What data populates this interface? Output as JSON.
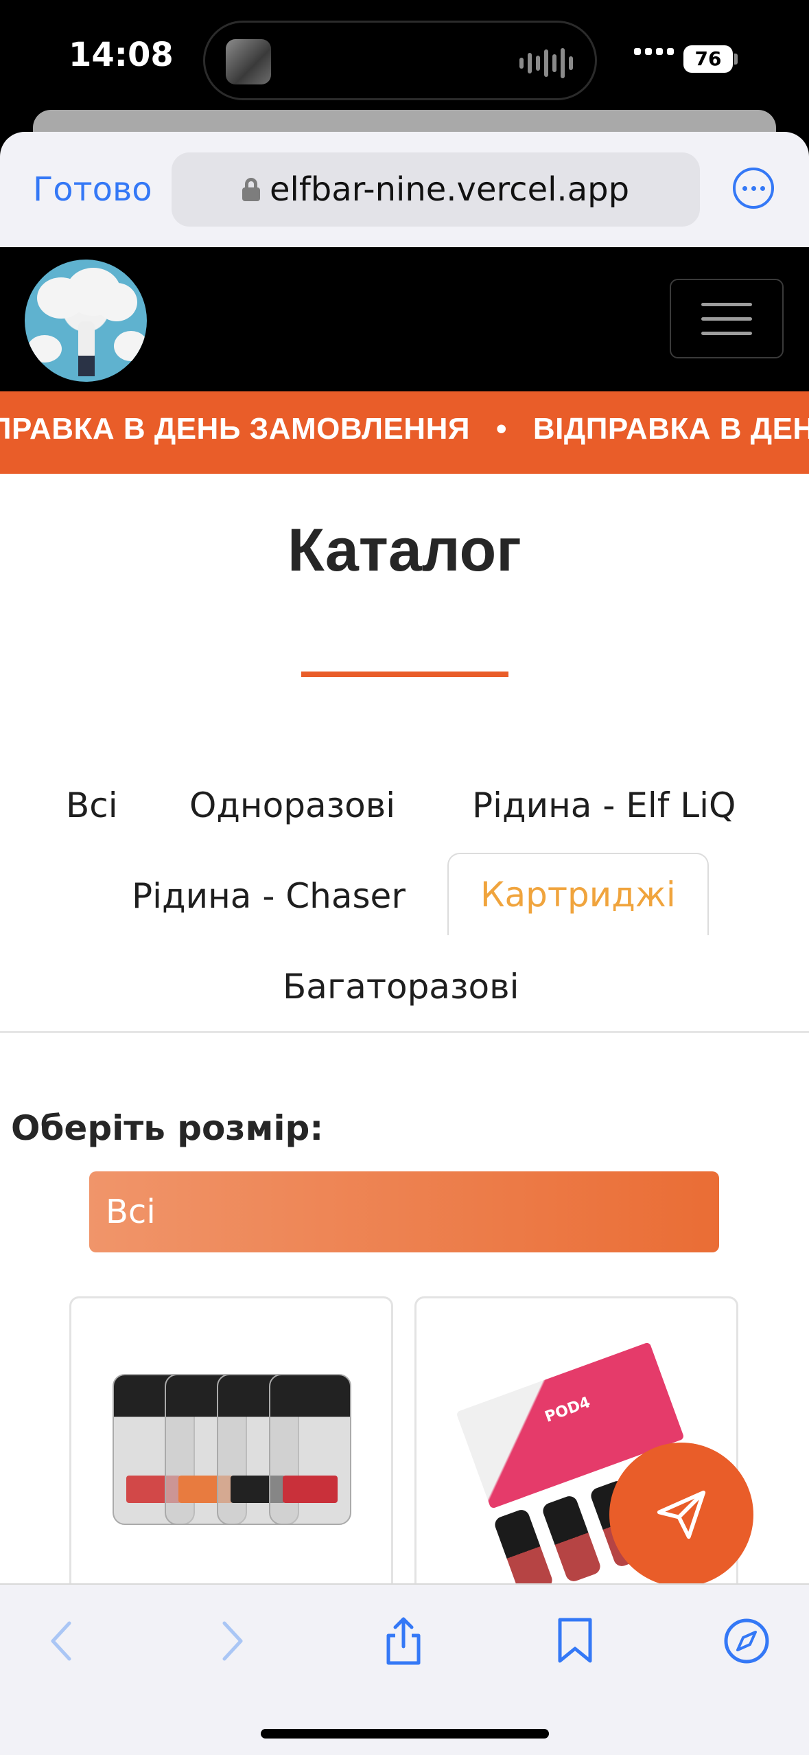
{
  "status_bar": {
    "time": "14:08",
    "battery": "76"
  },
  "browser": {
    "done_label": "Готово",
    "url": "elfbar-nine.vercel.app"
  },
  "marquee": {
    "text": "ВІДПРАВКА В ДЕНЬ ЗАМОВЛЕННЯ",
    "separator": "•"
  },
  "catalog": {
    "title": "Каталог",
    "tabs": [
      {
        "label": "Всі"
      },
      {
        "label": "Одноразові"
      },
      {
        "label": "Рідина - Elf LiQ"
      },
      {
        "label": "Рідина - Chaser"
      },
      {
        "label": "Картриджі",
        "active": true
      },
      {
        "label": "Багаторазові"
      }
    ],
    "size_label": "Оберіть розмір:",
    "size_selected": "Всі"
  },
  "products": [
    {
      "image": "pod-cartridges-image"
    },
    {
      "image": "pod4-box-image",
      "box_text": "POD4"
    }
  ],
  "colors": {
    "accent": "#e95d29",
    "active_tab": "#f0a43d",
    "safari_blue": "#3478f6"
  },
  "icons": {
    "fab": "paper-plane-icon",
    "toolbar": [
      "back-icon",
      "forward-icon",
      "share-icon",
      "bookmarks-icon",
      "compass-icon"
    ]
  }
}
